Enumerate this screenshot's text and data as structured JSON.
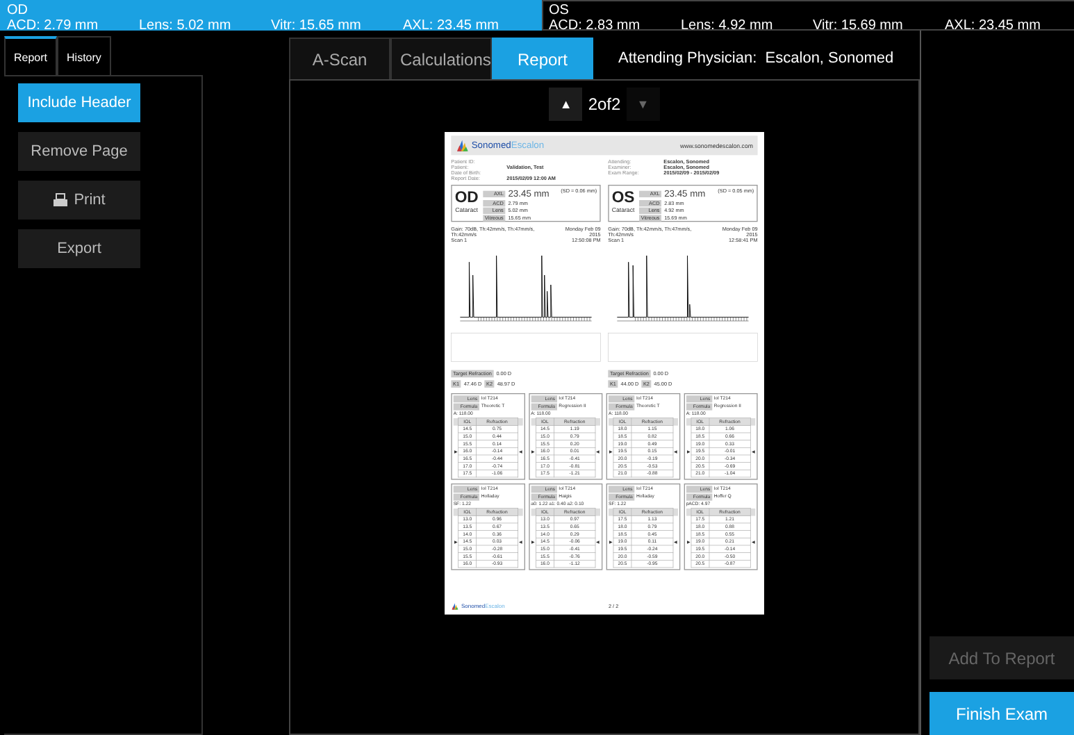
{
  "eyes_bar": [
    {
      "eye": "OD",
      "selected": true,
      "values": [
        "ACD: 2.79 mm",
        "Lens: 5.02 mm",
        "Vitr: 15.65 mm",
        "AXL: 23.45 mm"
      ]
    },
    {
      "eye": "OS",
      "selected": false,
      "values": [
        "ACD: 2.83 mm",
        "Lens: 4.92 mm",
        "Vitr: 15.69 mm",
        "AXL: 23.45 mm"
      ]
    }
  ],
  "side_tabs": [
    {
      "label": "Report",
      "selected": true
    },
    {
      "label": "History",
      "selected": false
    }
  ],
  "side_buttons": [
    {
      "label": "Include Header",
      "selected": true,
      "kind": "toggle"
    },
    {
      "label": "Remove Page",
      "selected": false,
      "kind": "plain"
    },
    {
      "label": "Print",
      "selected": false,
      "kind": "print"
    },
    {
      "label": "Export",
      "selected": false,
      "kind": "plain"
    }
  ],
  "main_tabs": [
    {
      "label": "A-Scan",
      "selected": false
    },
    {
      "label": "Calculations",
      "selected": false
    },
    {
      "label": "Report",
      "selected": true
    }
  ],
  "attending": {
    "label": "Attending Physician:",
    "value": "Escalon, Sonomed"
  },
  "pager": {
    "up": "▲",
    "text": "2of2",
    "down": "▼",
    "up_disabled": false,
    "down_disabled": true
  },
  "report": {
    "logo": {
      "first": "Sonomed",
      "second": "Escalon"
    },
    "website": "www.sonomedescalon.com",
    "info_left": [
      {
        "label": "Patient ID:"
      },
      {
        "label": "Patient:",
        "value": "Validation, Test"
      },
      {
        "label": "Date of Birth:"
      },
      {
        "label": "Report Date:",
        "value": "2015/02/09 12:00 AM"
      }
    ],
    "info_right": [
      {
        "label": "Attending:",
        "value": "Escalon, Sonomed"
      },
      {
        "label": "Examiner:",
        "value": "Escalon, Sonomed"
      },
      {
        "label": "Exam Range:",
        "value": "2015/02/09 - 2015/02/09"
      }
    ],
    "eyes": [
      {
        "eye": "OD",
        "status": "Cataract",
        "axl_label": "AXL",
        "axl": "23.45 mm",
        "sd": "(SD = 0.06 mm)",
        "rows": [
          [
            "ACD",
            "2.79 mm"
          ],
          [
            "Lens",
            "5.02 mm"
          ],
          [
            "Vitreous",
            "15.65 mm"
          ]
        ],
        "scan_caption": "Gain: 70dB, Th:42mm/s, Th:47mm/s, Th:42mm/s",
        "scan_sub": "Scan 1",
        "scan_date": "Monday Feb 09 2015",
        "scan_time": "12:50:08 PM",
        "target_label": "Target Refraction",
        "target": "0.00 D",
        "k1_label": "K1",
        "k1": "47.46 D",
        "k2_label": "K2",
        "k2": "48.97 D"
      },
      {
        "eye": "OS",
        "status": "Cataract",
        "axl_label": "AXL",
        "axl": "23.45 mm",
        "sd": "(SD = 0.05 mm)",
        "rows": [
          [
            "ACD",
            "2.83 mm"
          ],
          [
            "Lens",
            "4.92 mm"
          ],
          [
            "Vitreous",
            "15.69 mm"
          ]
        ],
        "scan_caption": "Gain: 70dB, Th:42mm/s, Th:47mm/s, Th:42mm/s",
        "scan_sub": "Scan 1",
        "scan_date": "Monday Feb 09 2015",
        "scan_time": "12:58:41 PM",
        "target_label": "Target Refraction",
        "target": "0.00 D",
        "k1_label": "K1",
        "k1": "44.00 D",
        "k2_label": "K2",
        "k2": "45.00 D"
      }
    ],
    "tables": [
      {
        "lens_label": "Lens",
        "lens": "Iol T214",
        "formula_label": "Formula",
        "formula": "Theoretic T",
        "constant": "A: 118.00",
        "iol_label": "IOL",
        "refraction_label": "Refraction",
        "rows": [
          [
            "14.5",
            "0.75",
            false
          ],
          [
            "15.0",
            "0.44",
            false
          ],
          [
            "15.5",
            "0.14",
            false
          ],
          [
            "16.0",
            "-0.14",
            true
          ],
          [
            "16.5",
            "-0.44",
            false
          ],
          [
            "17.0",
            "-0.74",
            false
          ],
          [
            "17.5",
            "-1.06",
            false
          ]
        ]
      },
      {
        "lens_label": "Lens",
        "lens": "Iol T214",
        "formula_label": "Formula",
        "formula": "Regression II",
        "constant": "A: 118.00",
        "iol_label": "IOL",
        "refraction_label": "Refraction",
        "rows": [
          [
            "14.5",
            "1.19",
            false
          ],
          [
            "15.0",
            "0.79",
            false
          ],
          [
            "15.5",
            "0.20",
            false
          ],
          [
            "16.0",
            "0.01",
            true
          ],
          [
            "16.5",
            "-0.41",
            false
          ],
          [
            "17.0",
            "-0.81",
            false
          ],
          [
            "17.5",
            "-1.21",
            false
          ]
        ]
      },
      {
        "lens_label": "Lens",
        "lens": "Iol T214",
        "formula_label": "Formula",
        "formula": "Theoretic T",
        "constant": "A: 118.00",
        "iol_label": "IOL",
        "refraction_label": "Refraction",
        "rows": [
          [
            "18.0",
            "1.15",
            false
          ],
          [
            "18.5",
            "0.82",
            false
          ],
          [
            "19.0",
            "0.49",
            false
          ],
          [
            "19.5",
            "0.15",
            true
          ],
          [
            "20.0",
            "-0.19",
            false
          ],
          [
            "20.5",
            "-0.53",
            false
          ],
          [
            "21.0",
            "-0.88",
            false
          ]
        ]
      },
      {
        "lens_label": "Lens",
        "lens": "Iol T214",
        "formula_label": "Formula",
        "formula": "Regression II",
        "constant": "A: 118.00",
        "iol_label": "IOL",
        "refraction_label": "Refraction",
        "rows": [
          [
            "18.0",
            "1.06",
            false
          ],
          [
            "18.5",
            "0.66",
            false
          ],
          [
            "19.0",
            "0.33",
            false
          ],
          [
            "19.5",
            "-0.01",
            true
          ],
          [
            "20.0",
            "-0.34",
            false
          ],
          [
            "20.5",
            "-0.69",
            false
          ],
          [
            "21.0",
            "-1.04",
            false
          ]
        ]
      },
      {
        "lens_label": "Lens",
        "lens": "Iol T214",
        "formula_label": "Formula",
        "formula": "Holladay",
        "constant": "SF: 1.22",
        "iol_label": "IOL",
        "refraction_label": "Refraction",
        "rows": [
          [
            "13.0",
            "0.96",
            false
          ],
          [
            "13.5",
            "0.67",
            false
          ],
          [
            "14.0",
            "0.36",
            false
          ],
          [
            "14.5",
            "0.03",
            true
          ],
          [
            "15.0",
            "-0.28",
            false
          ],
          [
            "15.5",
            "-0.61",
            false
          ],
          [
            "16.0",
            "-0.93",
            false
          ]
        ]
      },
      {
        "lens_label": "Lens",
        "lens": "Iol T214",
        "formula_label": "Formula",
        "formula": "Haigis",
        "constant": "a0: 1.22 a1: 0.40 a2: 0.10",
        "iol_label": "IOL",
        "refraction_label": "Refraction",
        "rows": [
          [
            "13.0",
            "0.97",
            false
          ],
          [
            "13.5",
            "0.65",
            false
          ],
          [
            "14.0",
            "0.29",
            false
          ],
          [
            "14.5",
            "-0.06",
            true
          ],
          [
            "15.0",
            "-0.41",
            false
          ],
          [
            "15.5",
            "-0.76",
            false
          ],
          [
            "16.0",
            "-1.12",
            false
          ]
        ]
      },
      {
        "lens_label": "Lens",
        "lens": "Iol T214",
        "formula_label": "Formula",
        "formula": "Holladay",
        "constant": "SF: 1.22",
        "iol_label": "IOL",
        "refraction_label": "Refraction",
        "rows": [
          [
            "17.5",
            "1.13",
            false
          ],
          [
            "18.0",
            "0.79",
            false
          ],
          [
            "18.5",
            "0.45",
            false
          ],
          [
            "19.0",
            "0.11",
            true
          ],
          [
            "19.5",
            "-0.24",
            false
          ],
          [
            "20.0",
            "-0.59",
            false
          ],
          [
            "20.5",
            "-0.95",
            false
          ]
        ]
      },
      {
        "lens_label": "Lens",
        "lens": "Iol T214",
        "formula_label": "Formula",
        "formula": "Hoffer Q",
        "constant": "pACD: 4.97",
        "iol_label": "IOL",
        "refraction_label": "Refraction",
        "rows": [
          [
            "17.5",
            "1.21",
            false
          ],
          [
            "18.0",
            "0.88",
            false
          ],
          [
            "18.5",
            "0.55",
            false
          ],
          [
            "19.0",
            "0.21",
            true
          ],
          [
            "19.5",
            "-0.14",
            false
          ],
          [
            "20.0",
            "-0.50",
            false
          ],
          [
            "20.5",
            "-0.87",
            false
          ]
        ]
      }
    ],
    "footer_logo": {
      "first": "Sonomed",
      "second": "Escalon"
    },
    "marker_left": "▶",
    "marker_right": "◀",
    "page_number": "2 / 2"
  },
  "right_buttons": [
    {
      "label": "Add To Report",
      "disabled": true
    },
    {
      "label": "Finish Exam",
      "disabled": false
    }
  ]
}
